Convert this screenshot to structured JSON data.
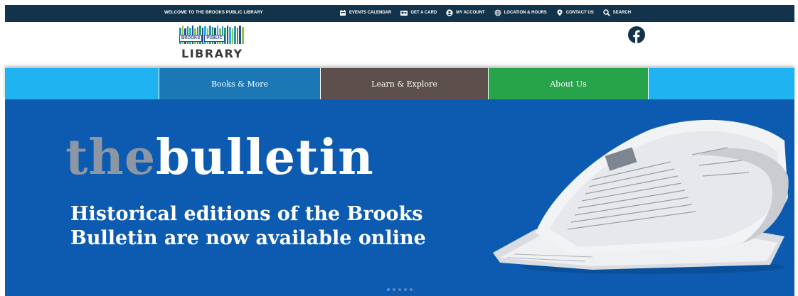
{
  "topbar": {
    "welcome": "WELCOME TO THE BROOKS PUBLIC LIBRARY",
    "links": [
      {
        "label": "EVENTS CALENDAR",
        "icon": "calendar-icon"
      },
      {
        "label": "GET A CARD",
        "icon": "id-card-icon"
      },
      {
        "label": "MY ACCOUNT",
        "icon": "user-circle-icon"
      },
      {
        "label": "LOCATION & HOURS",
        "icon": "globe-icon"
      },
      {
        "label": "CONTACT US",
        "icon": "map-pin-icon"
      },
      {
        "label": "SEARCH",
        "icon": "search-icon"
      }
    ]
  },
  "logo": {
    "box_left": "BROOKS",
    "box_right": "PUBLIC",
    "word": "LIBRARY"
  },
  "social": {
    "icon": "facebook-icon"
  },
  "nav": {
    "items": [
      {
        "label": "Books & More",
        "color": "#1b78b4"
      },
      {
        "label": "Learn & Explore",
        "color": "#5c4f4c"
      },
      {
        "label": "About Us",
        "color": "#27a349"
      }
    ],
    "bar_color": "#1fb3f1"
  },
  "hero": {
    "title_part1": "the",
    "title_part2": "bulletin",
    "subtitle_line1": "Historical editions of the Brooks",
    "subtitle_line2": "Bulletin are now available online",
    "background": "#0d5bb0",
    "slide_count": 5,
    "active_slide": 1
  }
}
